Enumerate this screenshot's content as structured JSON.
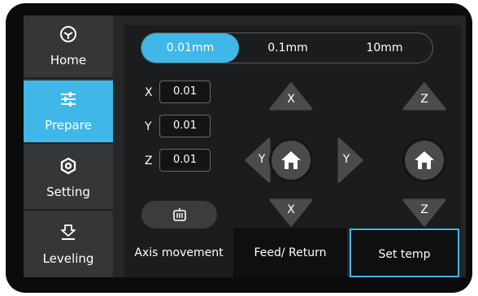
{
  "sidebar": {
    "items": [
      {
        "label": "Home",
        "icon": "cube-icon",
        "active": false
      },
      {
        "label": "Prepare",
        "icon": "sliders-icon",
        "active": true
      },
      {
        "label": "Setting",
        "icon": "settings-icon",
        "active": false
      },
      {
        "label": "Leveling",
        "icon": "leveling-icon",
        "active": false
      }
    ]
  },
  "step_selector": {
    "options": [
      "0.01mm",
      "0.1mm",
      "10mm"
    ],
    "selected": "0.01mm"
  },
  "step_values": [
    {
      "axis": "X",
      "value": "0.01"
    },
    {
      "axis": "Y",
      "value": "0.01"
    },
    {
      "axis": "Z",
      "value": "0.01"
    }
  ],
  "jog": {
    "x_up": "X",
    "x_down": "X",
    "y_left": "Y",
    "y_right": "Y",
    "z_up": "Z",
    "z_down": "Z"
  },
  "bottom_tabs": [
    {
      "label": "Axis movement",
      "selected": false
    },
    {
      "label": "Feed/ Return",
      "selected": false
    },
    {
      "label": "Set temp",
      "selected": true
    }
  ],
  "colors": {
    "accent": "#3fb7e8",
    "panel": "#1b1c1d",
    "sidebar": "#353637",
    "button": "#4a4b4c"
  }
}
